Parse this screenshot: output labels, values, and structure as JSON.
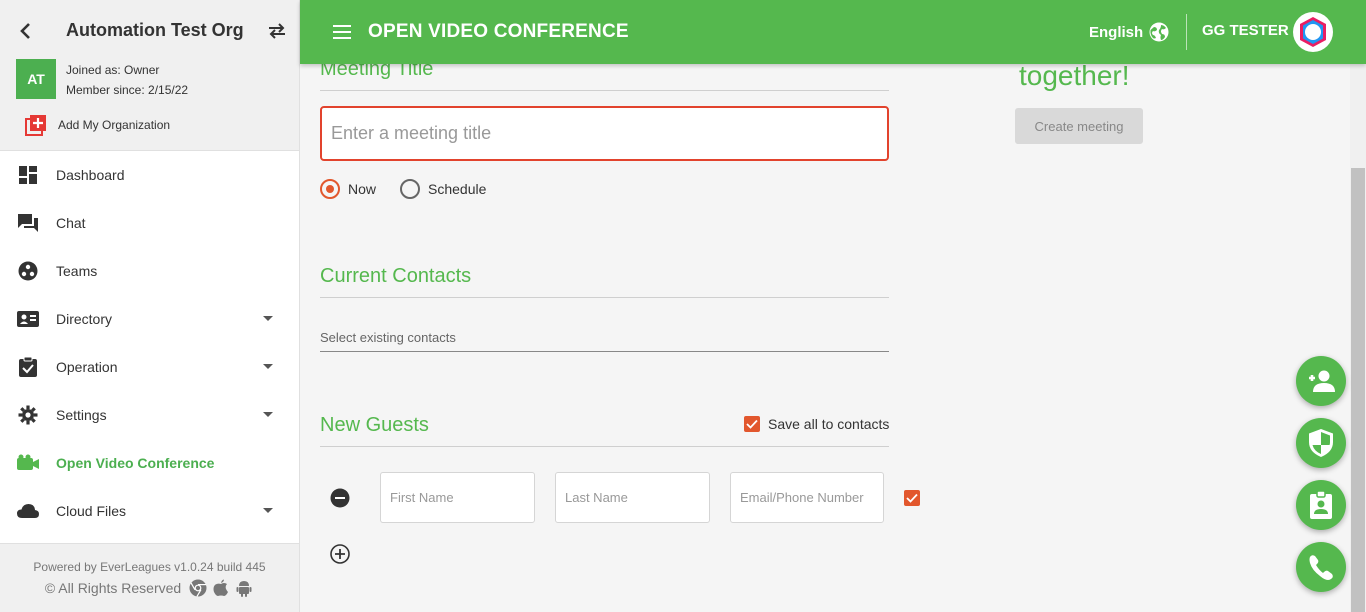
{
  "sidebar": {
    "org_name": "Automation Test Org",
    "avatar_initials": "AT",
    "joined_as": "Joined as: Owner",
    "member_since": "Member since: 2/15/22",
    "add_org_label": "Add My Organization",
    "items": [
      {
        "label": "Dashboard",
        "icon": "dashboard-icon"
      },
      {
        "label": "Chat",
        "icon": "chat-icon"
      },
      {
        "label": "Teams",
        "icon": "teams-icon"
      },
      {
        "label": "Directory",
        "icon": "directory-icon"
      },
      {
        "label": "Operation",
        "icon": "clipboard-check-icon"
      },
      {
        "label": "Settings",
        "icon": "gear-icon"
      },
      {
        "label": "Open Video Conference",
        "icon": "video-camera-icon"
      },
      {
        "label": "Cloud Files",
        "icon": "cloud-icon"
      }
    ],
    "footer": {
      "powered_by": "Powered by EverLeagues v1.0.24 build 445",
      "rights": "© All Rights Reserved"
    }
  },
  "header": {
    "title": "OPEN VIDEO CONFERENCE",
    "language": "English",
    "user_name": "GG TESTER"
  },
  "meeting": {
    "title_label": "Meeting Title",
    "title_placeholder": "Enter a meeting title",
    "radio_now": "Now",
    "radio_schedule": "Schedule"
  },
  "contacts": {
    "title": "Current Contacts",
    "select_placeholder": "Select existing contacts"
  },
  "guests": {
    "title": "New Guests",
    "save_all_label": "Save all to contacts",
    "first_name_placeholder": "First Name",
    "last_name_placeholder": "Last Name",
    "email_placeholder": "Email/Phone Number"
  },
  "side_panel": {
    "tagline": "together!",
    "create_button": "Create meeting"
  },
  "colors": {
    "brand_green": "#55b84e",
    "accent_orange": "#e2572d",
    "error_red": "#e2432d"
  }
}
